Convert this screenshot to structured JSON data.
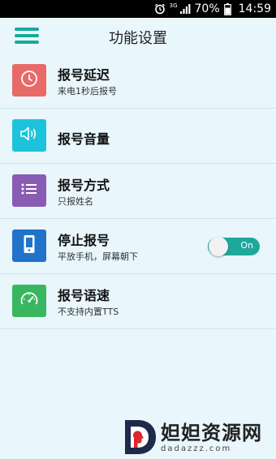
{
  "status_bar": {
    "network": "3G",
    "battery": "70%",
    "time": "14:59",
    "icons": [
      "alarm-icon",
      "signal-icon",
      "battery-icon"
    ]
  },
  "app_bar": {
    "title": "功能设置",
    "menu_icon": "hamburger-menu-icon"
  },
  "settings": [
    {
      "title": "报号延迟",
      "subtitle": "来电1秒后报号",
      "icon": "clock-icon",
      "color": "#e86a68"
    },
    {
      "title": "报号音量",
      "subtitle": "",
      "icon": "speaker-icon",
      "color": "#1cc3db"
    },
    {
      "title": "报号方式",
      "subtitle": "只报姓名",
      "icon": "list-icon",
      "color": "#8a5bb3"
    },
    {
      "title": "停止报号",
      "subtitle": "平放手机，屏幕朝下",
      "icon": "phone-icon",
      "color": "#2172c9",
      "toggle": {
        "label": "On",
        "state": "on"
      }
    },
    {
      "title": "报号语速",
      "subtitle": "不支持内置TTS",
      "icon": "speedometer-icon",
      "color": "#38b760"
    }
  ],
  "watermark": {
    "name": "妲妲资源网",
    "url": "dadazzz.com",
    "logo_letter": "D"
  },
  "colors": {
    "accent": "#18a99e",
    "background": "#e9f6fb"
  }
}
